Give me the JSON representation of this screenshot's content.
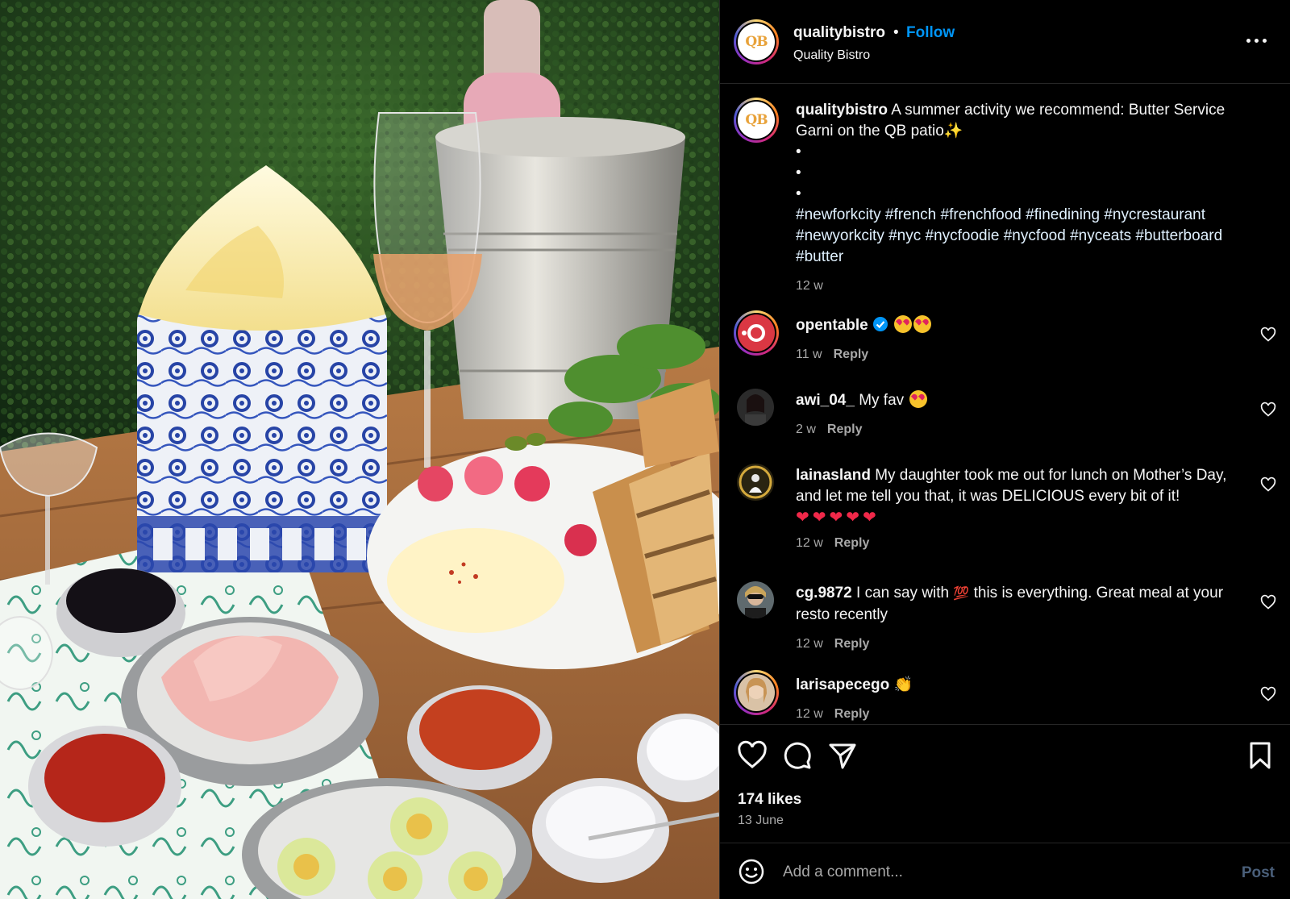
{
  "post": {
    "username": "qualitybistro",
    "follow_label": "Follow",
    "location": "Quality Bistro",
    "avatar_text": "QB",
    "photo_description_icon": "food-photo"
  },
  "caption": {
    "username": "qualitybistro",
    "text": "A summer activity we recommend: Butter Service Garni on the QB patio",
    "emoji": "✨",
    "bullets": [
      "•",
      "•",
      "•"
    ],
    "hashtags": "#newforkcity #french #frenchfood #finedining #nycrestaurant #newyorkcity #nyc #nycfoodie #nycfood #nyceats #butterboard #butter",
    "time": "12 w"
  },
  "comments": [
    {
      "username": "opentable",
      "verified": true,
      "text": "",
      "time": "11 w",
      "reply": "Reply"
    },
    {
      "username": "awi_04_",
      "text": "My fav",
      "time": "2 w",
      "reply": "Reply"
    },
    {
      "username": "lainasland",
      "text": "My daughter took me out for lunch on Mother’s Day, and let me tell you that, it was DELICIOUS every bit of it!",
      "hearts": "❤❤❤❤❤",
      "time": "12 w",
      "reply": "Reply"
    },
    {
      "username": "cg.9872",
      "text_before": "I can say with",
      "emoji": "💯",
      "text_after": "this is everything. Great meal at your resto recently",
      "time": "12 w",
      "reply": "Reply"
    },
    {
      "username": "larisapecego",
      "emoji": "👏",
      "time": "12 w",
      "reply": "Reply"
    }
  ],
  "footer": {
    "likes": "174 likes",
    "date": "13 June",
    "comment_placeholder": "Add a comment...",
    "post_label": "Post"
  },
  "colors": {
    "follow_blue": "#0095f6",
    "background": "#000000",
    "muted_text": "#a8a8a8",
    "post_disabled": "#4a5f7a"
  }
}
